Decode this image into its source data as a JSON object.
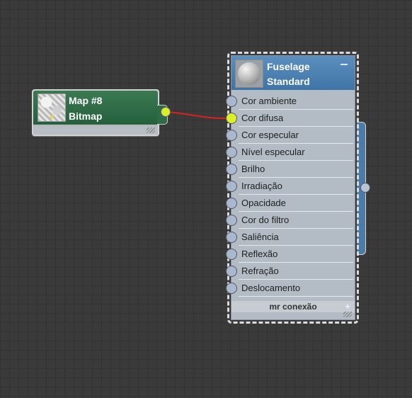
{
  "bitmap_node": {
    "title": "Map #8",
    "subtitle": "Bitmap"
  },
  "material_node": {
    "title": "Fuselage",
    "subtitle": "Standard",
    "slots": [
      {
        "label": "Cor ambiente",
        "connected": false
      },
      {
        "label": "Cor difusa",
        "connected": true
      },
      {
        "label": "Cor especular",
        "connected": false
      },
      {
        "label": "Nível especular",
        "connected": false
      },
      {
        "label": "Brilho",
        "connected": false
      },
      {
        "label": "Irradiação",
        "connected": false
      },
      {
        "label": "Opacidade",
        "connected": false
      },
      {
        "label": "Cor do filtro",
        "connected": false
      },
      {
        "label": "Saliência",
        "connected": false
      },
      {
        "label": "Reflexão",
        "connected": false
      },
      {
        "label": "Refração",
        "connected": false
      },
      {
        "label": "Deslocamento",
        "connected": false
      }
    ],
    "footer_label": "mr conexão"
  },
  "colors": {
    "background": "#3a3a3a",
    "bitmap_header": "#2e6b46",
    "material_header": "#4a80b2",
    "active_socket": "#d8f02a",
    "wire": "#e02020"
  },
  "icons": {
    "collapse": "minus-icon",
    "expand": "plus-icon",
    "bitmap_preview": "bitmap-thumbnail",
    "material_preview": "sphere-preview"
  }
}
